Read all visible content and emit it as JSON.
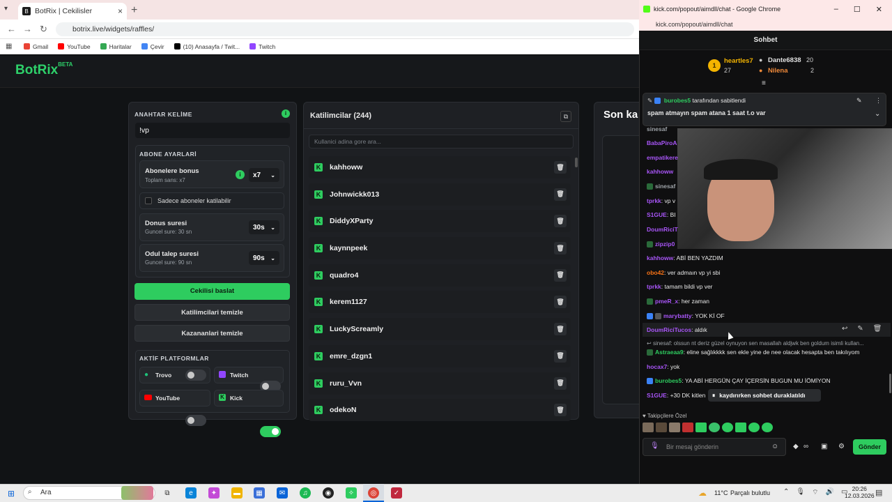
{
  "browser": {
    "tab_title": "BotRix | Cekilisler",
    "url": "botrix.live/widgets/raffles/",
    "bookmarks": [
      "Gmail",
      "YouTube",
      "Haritalar",
      "Çevir",
      "(10) Anasayfa / Twit...",
      "Twitch"
    ]
  },
  "app": {
    "logo": "BotRix",
    "logo_badge": "BETA"
  },
  "settings": {
    "keyword_label": "ANAHTAR KELİME",
    "keyword_value": "!vp",
    "sub_section_label": "ABONE AYARLARİ",
    "sub_bonus_title": "Abonelere bonus",
    "sub_bonus_sub": "Toplam sans: x7",
    "sub_bonus_value": "x7",
    "only_subs_label": "Sadece aboneler katilabilir",
    "spin_title": "Donus suresi",
    "spin_sub": "Guncel sure: 30 sn",
    "spin_value": "30s",
    "claim_title": "Odul talep suresi",
    "claim_sub": "Guncel sure: 90 sn",
    "claim_value": "90s",
    "start_btn": "Cekilisi baslat",
    "clear_participants_btn": "Katilimcilari temizle",
    "clear_winners_btn": "Kazananlari temizle",
    "platforms_label": "AKTİF PLATFORMLAR",
    "platforms": [
      {
        "name": "Trovo",
        "on": false
      },
      {
        "name": "Twitch",
        "on": false
      },
      {
        "name": "YouTube",
        "on": false
      },
      {
        "name": "Kick",
        "on": true
      }
    ]
  },
  "participants": {
    "title": "Katilimcilar (244)",
    "search_placeholder": "Kullanici adina gore ara...",
    "list": [
      "kahhoww",
      "Johnwickk013",
      "DiddyXParty",
      "kaynnpeek",
      "quadro4",
      "kerem1127",
      "LuckyScreamly",
      "emre_dzgn1",
      "ruru_Vvn",
      "odekoN"
    ]
  },
  "winners": {
    "title": "Son ka"
  },
  "chat": {
    "window_title": "kick.com/popout/aimdll/chat - Google Chrome",
    "url": "kick.com/popout/aimdll/chat",
    "header": "Sohbet",
    "leaderboard": {
      "first": {
        "rank": "1",
        "name": "heartles7",
        "count": "27"
      },
      "second": {
        "name": "Dante6838",
        "count": "20"
      },
      "third": {
        "name": "Nilena",
        "count": "2"
      }
    },
    "pinned_by": "burobes5",
    "pinned_suffix": "tarafından sabitlendi",
    "pinned_text": "spam atmayın spam atana 1 saat t.o var",
    "messages": [
      {
        "user": "sinesaf",
        "text": "",
        "color": "#9ea3a8"
      },
      {
        "user": "BabaPiroA",
        "text": "",
        "color": "#a855f7"
      },
      {
        "user": "empatikere",
        "text": "",
        "color": "#a855f7"
      },
      {
        "user": "kahhoww",
        "text": "",
        "color": "#a855f7"
      },
      {
        "user": "sinesaf",
        "text": "",
        "color": "#9ea3a8"
      },
      {
        "user": "tprkk",
        "text": "vp v",
        "color": "#a855f7"
      },
      {
        "user": "S1GUE",
        "text": "BI",
        "color": "#a855f7"
      },
      {
        "user": "DoumRiciT",
        "text": "",
        "color": "#a855f7"
      },
      {
        "user": "zipzip0",
        "text": "",
        "color": "#a855f7"
      },
      {
        "user": "kahhoww",
        "text": "ABİ BEN YAZDIM",
        "color": "#a855f7"
      },
      {
        "user": "obo42",
        "text": "ver admaın vp yi sbi",
        "color": "#f97316"
      },
      {
        "user": "tprkk",
        "text": "tamam bildi vp ver",
        "color": "#a855f7"
      },
      {
        "user": "pmeR_x",
        "text": "her zaman",
        "color": "#a855f7"
      },
      {
        "user": "marybatty",
        "text": "YOK Kİ OF",
        "color": "#a855f7"
      },
      {
        "user": "DoumRiciTucos",
        "text": "aldık",
        "color": "#a855f7"
      },
      {
        "user": "",
        "text": "sinesaf: olssun nt deriz güzel oynuyon sen masallah aldjwk ben goldum isimli kullan...",
        "color": "#9ea3a8"
      },
      {
        "user": "Astraeaa9",
        "text": "eline sağlıkkkk sen ekle yine de nee olacak hesapta ben takılıyom",
        "color": "#2ecc5f"
      },
      {
        "user": "hocax7",
        "text": "yok",
        "color": "#a855f7"
      },
      {
        "user": "burobes5",
        "text": "YA ABİ HERGÜN ÇAY İÇERSİN BUGUN MU İÖMİYON",
        "color": "#2ecc5f"
      },
      {
        "user": "S1GUE",
        "text": "+30 DK kitlen",
        "color": "#a855f7"
      }
    ],
    "paused_text": "kaydırırken sohbet duraklatıldı",
    "followers_label": "Takipçilere Özel",
    "input_placeholder": "Bir mesaj gönderin",
    "send_btn": "Gönder"
  },
  "taskbar": {
    "search": "Ara",
    "weather_temp": "11°C",
    "weather_text": "Parçalı bulutlu",
    "time": "20:26",
    "date": "12.03.2026"
  }
}
